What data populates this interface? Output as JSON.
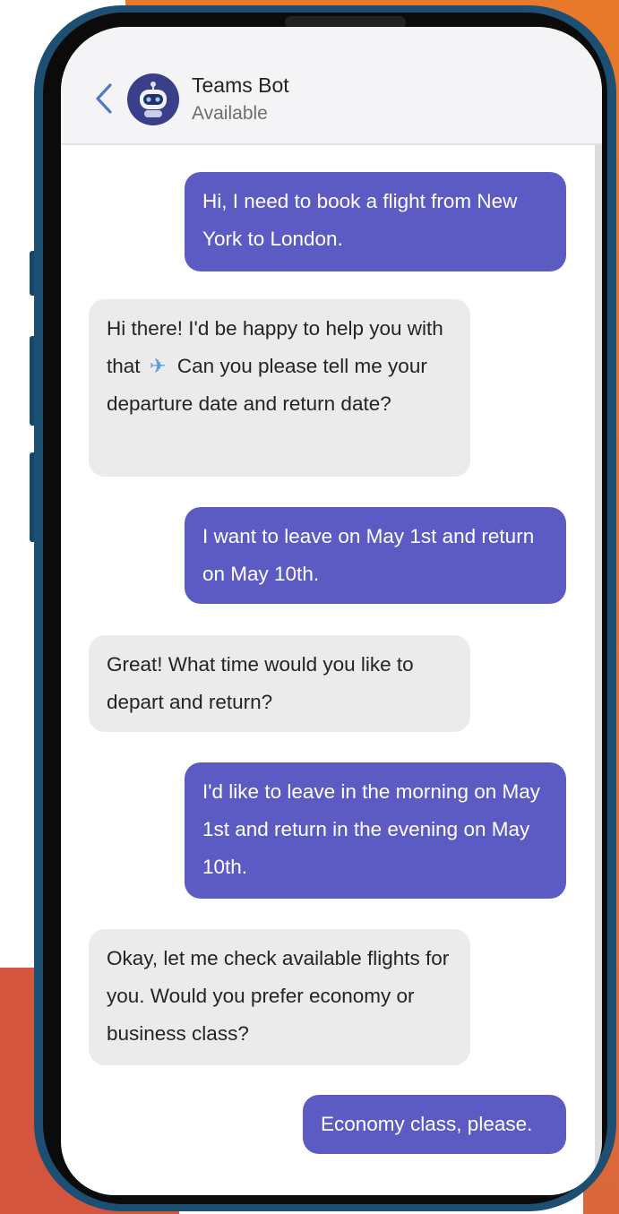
{
  "header": {
    "bot_name": "Teams Bot",
    "status": "Available",
    "back_icon": "chevron-left-icon",
    "avatar_icon": "robot-icon"
  },
  "colors": {
    "user_bubble": "#5b5bc3",
    "bot_bubble": "#ebebeb",
    "phone_frame": "#1c4f72",
    "bg_orange": "#e8792a",
    "bg_red": "#d4553e"
  },
  "messages": [
    {
      "sender": "user",
      "text": "Hi, I need to book a flight from New York to London."
    },
    {
      "sender": "bot",
      "text_before": "Hi there! I'd be happy to help you with that",
      "icon": "airplane-icon",
      "text_after": "Can you please tell me your departure date and return date?"
    },
    {
      "sender": "user",
      "text": "I want to leave on May 1st and return on May 10th."
    },
    {
      "sender": "bot",
      "text": "Great! What time would you like to depart and return?"
    },
    {
      "sender": "user",
      "text": "I'd like to leave in the morning on May 1st and return in the evening on May 10th."
    },
    {
      "sender": "bot",
      "text": "Okay, let me check available flights for you. Would you prefer economy or business class?"
    },
    {
      "sender": "user",
      "text": "Economy class, please."
    }
  ]
}
